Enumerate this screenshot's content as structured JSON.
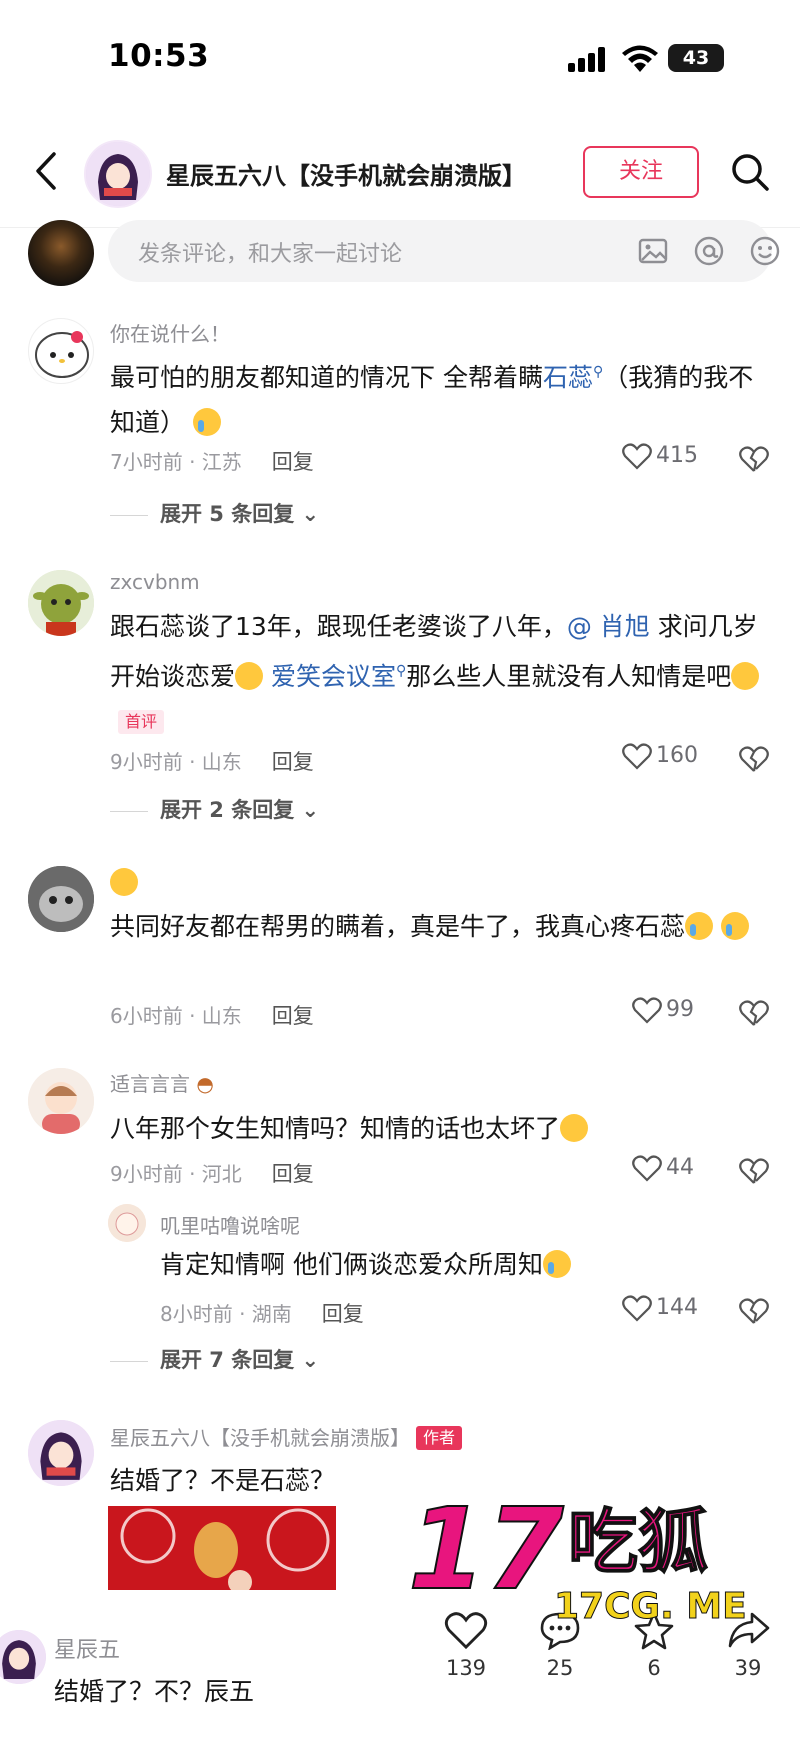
{
  "status": {
    "time": "10:53",
    "battery": "43"
  },
  "header": {
    "title": "星辰五六八【没手机就会崩溃版】",
    "follow_label": "关注"
  },
  "composer": {
    "placeholder": "发条评论，和大家一起讨论"
  },
  "comments": [
    {
      "name": "你在说什么！",
      "text_a": "最可怕的朋友都知道的情况下 全帮着瞒",
      "link": "石蕊",
      "text_b": "（我猜的我不知道）",
      "time_loc": "7小时前 · 江苏",
      "reply_label": "回复",
      "likes": "415",
      "expand": "展开 5 条回复"
    },
    {
      "name": "zxcvbnm",
      "text_a": "跟石蕊谈了13年，跟现任老婆谈了八年，",
      "mention": "@ 肖旭",
      "text_b": " 求问几岁开始谈恋爱",
      "link": "爱笑会议室",
      "text_c": "那么些人里就没有人知情是吧",
      "badge": "首评",
      "time_loc": "9小时前 · 山东",
      "reply_label": "回复",
      "likes": "160",
      "expand": "展开 2 条回复"
    },
    {
      "name": "",
      "text_a": "共同好友都在帮男的瞒着，真是牛了，我真心疼石蕊",
      "time_loc": "6小时前 · 山东",
      "reply_label": "回复",
      "likes": "99"
    },
    {
      "name": "适言言言",
      "text_a": "八年那个女生知情吗？知情的话也太坏了",
      "time_loc": "9小时前 · 河北",
      "reply_label": "回复",
      "likes": "44",
      "sub": {
        "name": "叽里咕噜说啥呢",
        "text": "肯定知情啊 他们俩谈恋爱众所周知",
        "time_loc": "8小时前 · 湖南",
        "reply_label": "回复",
        "likes": "144"
      },
      "expand": "展开 7 条回复"
    },
    {
      "name": "星辰五六八【没手机就会崩溃版】",
      "badge": "作者",
      "text_a": "结婚了？不是石蕊？"
    }
  ],
  "bottom": {
    "name": "星辰五",
    "text": "结婚了？不？辰五",
    "likes": "139",
    "comments": "25",
    "favorites": "6",
    "shares": "39"
  },
  "watermark": {
    "main": "17吃狐",
    "sub": "17CG. ME"
  },
  "colors": {
    "accent": "#e8365b",
    "link": "#2f63b0"
  }
}
